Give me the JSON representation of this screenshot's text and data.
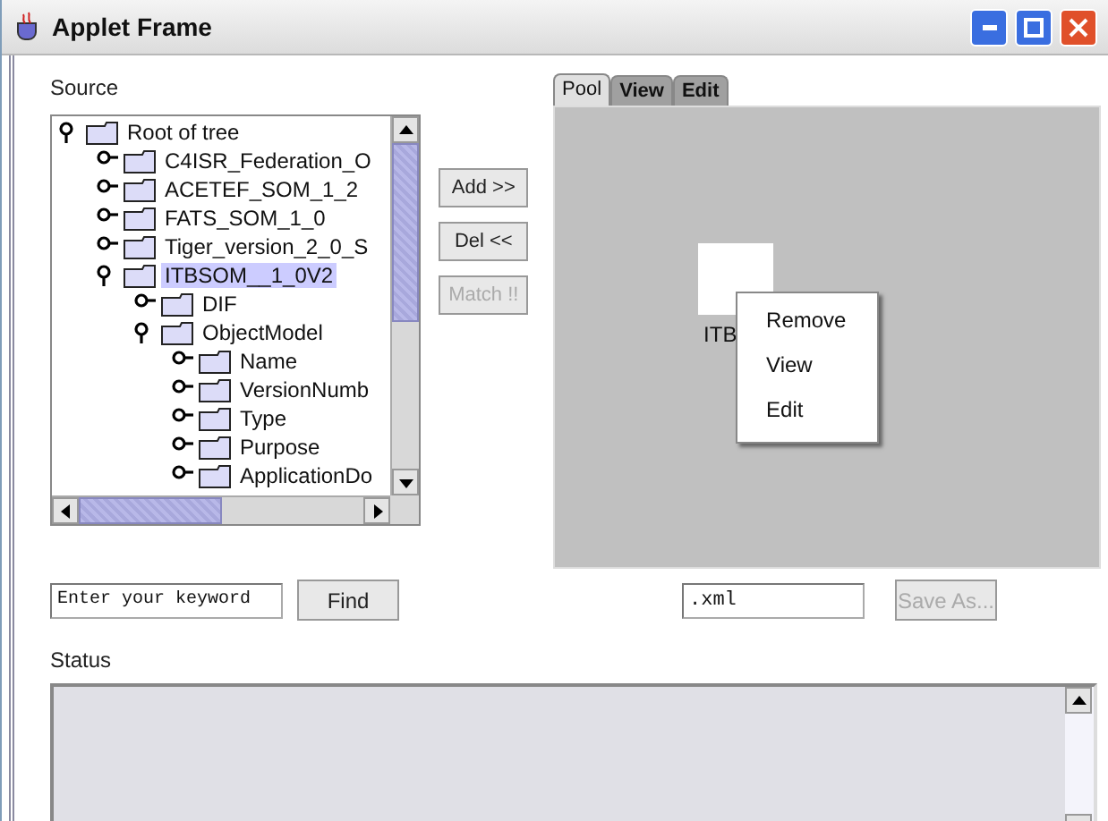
{
  "window": {
    "title": "Applet Frame"
  },
  "source": {
    "label": "Source",
    "tree": [
      {
        "label": "Root of tree",
        "expanded": true,
        "selected": false,
        "children": [
          {
            "label": "C4ISR_Federation_O",
            "expanded": false,
            "selected": false
          },
          {
            "label": "ACETEF_SOM_1_2",
            "expanded": false,
            "selected": false
          },
          {
            "label": "FATS_SOM_1_0",
            "expanded": false,
            "selected": false
          },
          {
            "label": "Tiger_version_2_0_S",
            "expanded": false,
            "selected": false
          },
          {
            "label": "ITBSOM__1_0V2",
            "expanded": true,
            "selected": true,
            "children": [
              {
                "label": "DIF",
                "expanded": false,
                "selected": false
              },
              {
                "label": "ObjectModel",
                "expanded": true,
                "selected": false,
                "children": [
                  {
                    "label": "Name",
                    "expanded": false,
                    "selected": false
                  },
                  {
                    "label": "VersionNumb",
                    "expanded": false,
                    "selected": false
                  },
                  {
                    "label": "Type",
                    "expanded": false,
                    "selected": false
                  },
                  {
                    "label": "Purpose",
                    "expanded": false,
                    "selected": false
                  },
                  {
                    "label": "ApplicationDo",
                    "expanded": false,
                    "selected": false
                  }
                ]
              }
            ]
          }
        ]
      }
    ]
  },
  "transfer_buttons": [
    {
      "label": "Add >>",
      "disabled": false
    },
    {
      "label": "Del <<",
      "disabled": false
    },
    {
      "label": "Match !!",
      "disabled": true
    }
  ],
  "tabs": [
    {
      "label": "Pool",
      "selected": true
    },
    {
      "label": "View",
      "selected": false
    },
    {
      "label": "Edit",
      "selected": false
    }
  ],
  "pool": {
    "items": [
      {
        "label": "ITB"
      }
    ],
    "context_menu": [
      "Remove",
      "View",
      "Edit"
    ]
  },
  "search": {
    "value": "Enter your keyword",
    "button": "Find"
  },
  "save": {
    "value": ".xml",
    "button": {
      "label": "Save As...",
      "disabled": true
    }
  },
  "status": {
    "label": "Status"
  }
}
